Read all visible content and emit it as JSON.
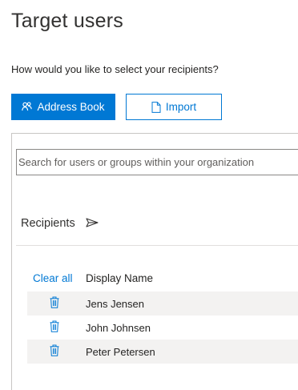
{
  "page": {
    "title": "Target users",
    "question": "How would you like to select your recipients?"
  },
  "buttons": {
    "address_book": "Address Book",
    "import": "Import"
  },
  "search": {
    "placeholder": "Search for users or groups within your organization"
  },
  "recipients": {
    "label": "Recipients",
    "clear_all": "Clear all",
    "column_display_name": "Display Name",
    "rows": [
      {
        "display_name": "Jens Jensen"
      },
      {
        "display_name": "John Johnsen"
      },
      {
        "display_name": "Peter Petersen"
      }
    ]
  },
  "colors": {
    "accent": "#0078d4",
    "row_alt": "#f3f2f1"
  },
  "icons": {
    "address_book": "people-icon",
    "import": "document-icon",
    "recipients": "send-icon",
    "row_action": "trash-icon"
  }
}
